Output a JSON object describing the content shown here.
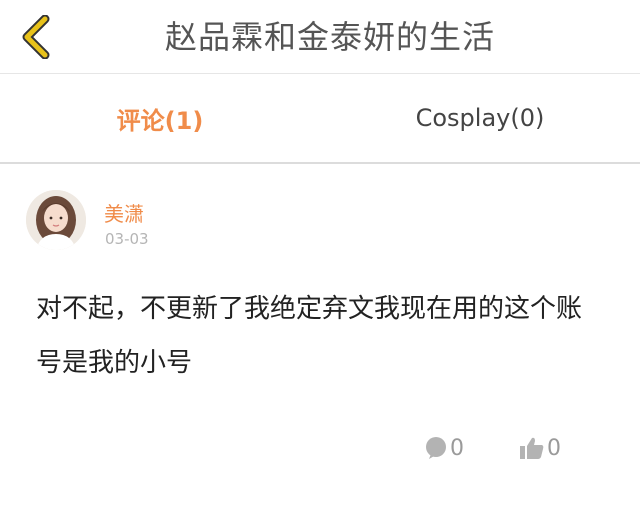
{
  "header": {
    "title": "赵品霖和金泰妍的生活",
    "back_icon": "chevron-left-icon",
    "back_icon_color": "#e8c21a"
  },
  "tabs": [
    {
      "label": "评论(1)",
      "active": true
    },
    {
      "label": "Cosplay(0)",
      "active": false
    }
  ],
  "comment": {
    "username": "美潇",
    "date": "03-03",
    "text": "对不起，不更新了我绝定弃文我现在用的这个账号是我的小号",
    "reply_count": "0",
    "like_count": "0"
  },
  "colors": {
    "accent": "#f08c4a",
    "muted": "#b5b5b5"
  }
}
